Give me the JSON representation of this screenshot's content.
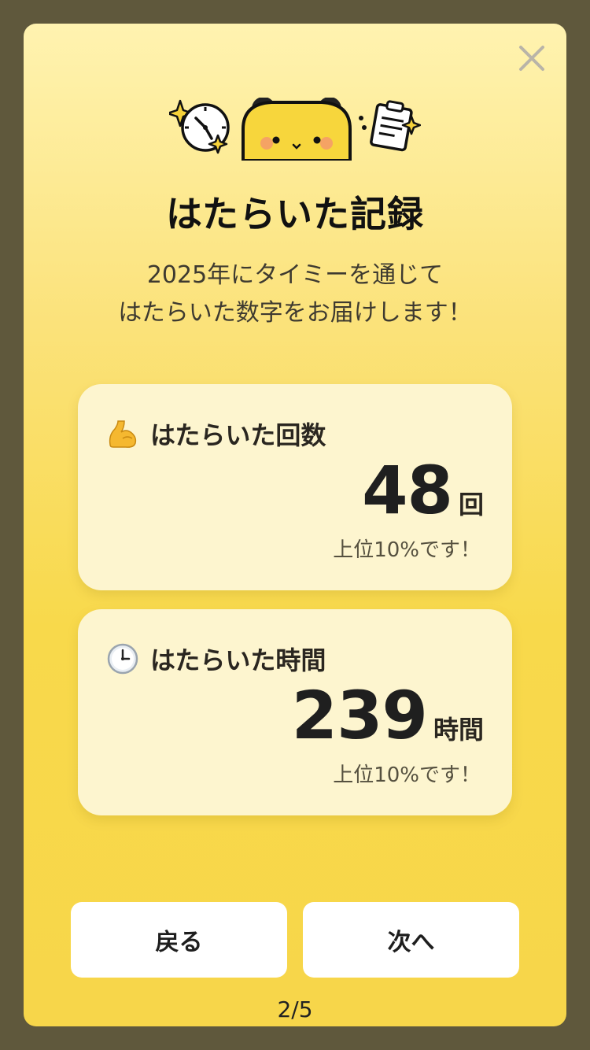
{
  "modal": {
    "title": "はたらいた記録",
    "subtitle_line1": "2025年にタイミーを通じて",
    "subtitle_line2": "はたらいた数字をお届けします！",
    "close_icon": "close-icon"
  },
  "cards": [
    {
      "icon": "flexed-biceps-icon",
      "label": "はたらいた回数",
      "value": "48",
      "unit": "回",
      "rank": "上位10%です！"
    },
    {
      "icon": "clock-icon",
      "label": "はたらいた時間",
      "value": "239",
      "unit": "時間",
      "rank": "上位10%です！"
    }
  ],
  "buttons": {
    "back": "戻る",
    "next": "次へ"
  },
  "pager": "2/5",
  "colors": {
    "background": "#5f583c",
    "modal_top": "#fff3b0",
    "modal_bottom": "#f7d64a",
    "card": "#fdf5cf",
    "button": "#ffffff"
  }
}
